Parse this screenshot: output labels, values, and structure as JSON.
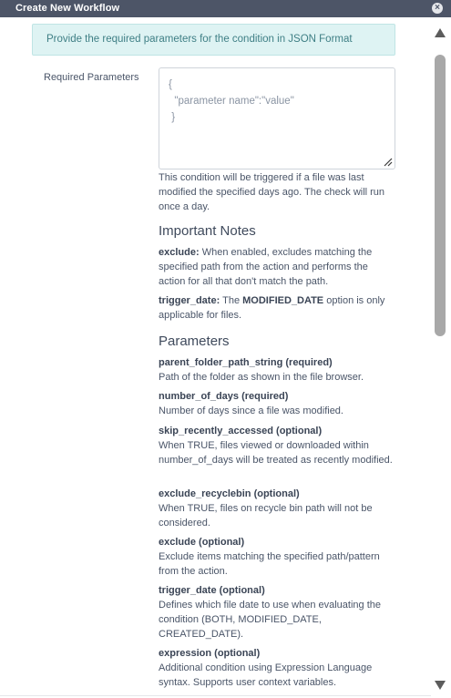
{
  "dialog": {
    "title": "Create New Workflow",
    "close_icon": "×"
  },
  "banner": {
    "text": "Provide the required parameters for the condition in JSON Format"
  },
  "form": {
    "label": "Required Parameters",
    "json_lines": [
      "{",
      "  \"parameter name\":\"value\"",
      " }"
    ],
    "helper": "This condition will be triggered if a file was last modified the specified days ago. The check will run once a day."
  },
  "notes": {
    "title": "Important Notes",
    "items": [
      {
        "key": "exclude:",
        "text": " When enabled, excludes matching the specified path from the action and performs the action for all that don't match the path."
      },
      {
        "key": "trigger_date:",
        "text": " The ",
        "bold2": "MODIFIED_DATE",
        "text2": " option is only applicable for files."
      }
    ]
  },
  "params": {
    "title": "Parameters",
    "items": [
      {
        "name": "parent_folder_path_string",
        "tag": " (required)",
        "desc": "Path of the folder as shown in the file browser."
      },
      {
        "name": "number_of_days",
        "tag": " (required)",
        "desc": "Number of days since a file was modified."
      },
      {
        "name": "skip_recently_accessed",
        "tag": " (optional)",
        "desc": "When TRUE, files viewed or downloaded within number_of_days will be treated as recently modified."
      },
      {
        "name": "exclude_recyclebin",
        "tag": " (optional)",
        "desc": "When TRUE, files on recycle bin path will not be considered."
      },
      {
        "name": "exclude",
        "tag": " (optional)",
        "desc": "Exclude items matching the specified path/pattern from the action."
      },
      {
        "name": "trigger_date",
        "tag": " (optional)",
        "desc": "Defines which file date to use when evaluating the condition (BOTH, MODIFIED_DATE, CREATED_DATE)."
      },
      {
        "name": "expression",
        "tag": " (optional)",
        "desc": "Additional condition using Expression Language syntax. Supports user context variables."
      }
    ]
  },
  "colors": {
    "titlebar": "#4d5567",
    "banner_bg": "#def3f3",
    "banner_text": "#3f7f85",
    "scroll_thumb": "#a8a8a8"
  },
  "icons": {
    "close": "close-icon",
    "resize": "resize-grip-icon",
    "scroll_up": "triangle-up-icon",
    "scroll_down": "triangle-down-icon"
  }
}
